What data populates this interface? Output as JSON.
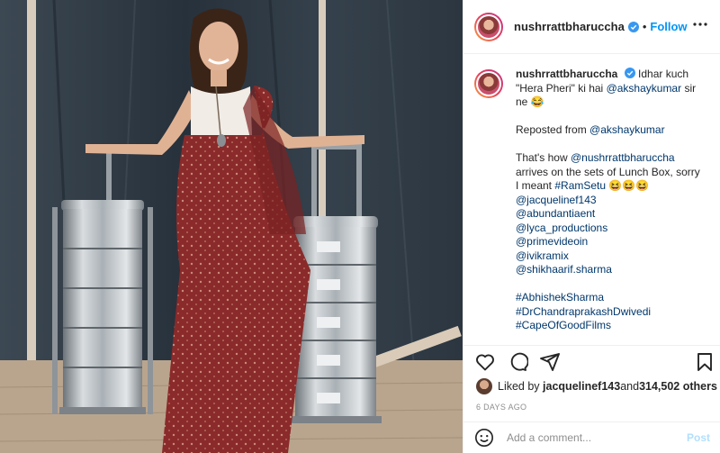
{
  "photo": {
    "alt_subject": "woman-in-red-saree-with-tiffin-boxes",
    "colors": {
      "tarp": "#2f3a45",
      "saree": "#8a2a2a",
      "steel": "#b9bfc4",
      "floor": "#b9a58e"
    }
  },
  "header": {
    "username": "nushrrattbharuccha",
    "separator": "•",
    "follow_label": "Follow"
  },
  "caption": {
    "username": "nushrrattbharuccha",
    "lines": [
      {
        "text": "Idhar kuch",
        "type": "first"
      },
      {
        "text": "\"Hera Pheri\" ki hai ",
        "mention": "@akshaykumar",
        "tail": " sir"
      },
      {
        "text": "ne 😂"
      },
      {
        "text": ""
      },
      {
        "text": "Reposted from ",
        "mention": "@akshaykumar"
      },
      {
        "text": ""
      },
      {
        "text": "That's how ",
        "mention": "@nushrrattbharuccha"
      },
      {
        "text": "arrives on the sets of Lunch Box, sorry"
      },
      {
        "text": "I meant ",
        "mention": "#RamSetu",
        "tail": " 😆😆😆"
      },
      {
        "mention": "@jacquelinef143"
      },
      {
        "mention": "@abundantiaent"
      },
      {
        "mention": "@lyca_productions"
      },
      {
        "mention": "@primevideoin"
      },
      {
        "mention": "@ivikramix"
      },
      {
        "mention": "@shikhaarif.sharma"
      },
      {
        "text": ""
      },
      {
        "mention": "#AbhishekSharma"
      },
      {
        "mention": "#DrChandraprakashDwivedi"
      },
      {
        "mention": "#CapeOfGoodFilms"
      }
    ]
  },
  "actions": {
    "like_icon": "heart-icon",
    "comment_icon": "comment-icon",
    "share_icon": "share-icon",
    "save_icon": "bookmark-icon"
  },
  "likes": {
    "prefix": "Liked by ",
    "liker": "jacquelinef143",
    "middle": " and ",
    "count": "314,502 others"
  },
  "timestamp": "6 DAYS AGO",
  "comment": {
    "placeholder": "Add a comment...",
    "post_label": "Post"
  },
  "colors": {
    "accent": "#0095f6",
    "link": "#00376b",
    "muted": "#8e8e8e",
    "post_disabled": "#b2dffc"
  }
}
